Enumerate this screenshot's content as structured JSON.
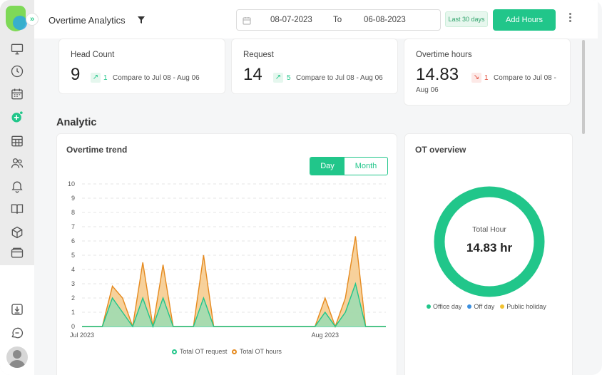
{
  "header": {
    "title": "Overtime Analytics",
    "date_from": "08-07-2023",
    "date_to_label": "To",
    "date_to": "06-08-2023",
    "range_badge": "Last 30 days",
    "add_button": "Add Hours"
  },
  "sidebar": {
    "icons": [
      "monitor-icon",
      "clock-icon",
      "calendar-icon",
      "add-circle-icon",
      "table-icon",
      "users-icon",
      "bell-icon",
      "book-icon",
      "box-icon",
      "wallet-icon",
      "download-icon",
      "chat-icon"
    ]
  },
  "stats": [
    {
      "label": "Head Count",
      "value": "9",
      "direction": "up",
      "change": "1",
      "compare": "Compare to Jul 08 - Aug 06"
    },
    {
      "label": "Request",
      "value": "14",
      "direction": "up",
      "change": "5",
      "compare": "Compare to Jul 08 - Aug 06"
    },
    {
      "label": "Overtime hours",
      "value": "14.83",
      "direction": "down",
      "change": "1",
      "compare": "Compare to Jul 08 -",
      "compare2": "Aug 06"
    }
  ],
  "analytic": {
    "section_title": "Analytic",
    "trend_title": "Overtime trend",
    "toggle_day": "Day",
    "toggle_month": "Month",
    "overview_title": "OT overview",
    "total_label": "Total Hour",
    "total_value": "14.83 hr"
  },
  "ot_legend": [
    {
      "label": "Office day",
      "color": "#21c68a"
    },
    {
      "label": "Off day",
      "color": "#3a8fe0"
    },
    {
      "label": "Public holiday",
      "color": "#f2c230"
    }
  ],
  "colors": {
    "accent": "#21c68a",
    "requests_fill": "#9fdcb1",
    "hours_fill": "#f6c98a",
    "hours_line": "#e58a1f"
  },
  "chart_data": {
    "type": "area",
    "x_tick_labels": [
      "Jul 2023",
      "Aug 2023"
    ],
    "x_tick_positions": [
      0,
      24
    ],
    "ylim": [
      0,
      10
    ],
    "y_ticks": [
      0,
      1,
      2,
      3,
      4,
      5,
      6,
      7,
      8,
      9,
      10
    ],
    "grid": true,
    "legend_placement": "bottom",
    "x": [
      0,
      1,
      2,
      3,
      4,
      5,
      6,
      7,
      8,
      9,
      10,
      11,
      12,
      13,
      14,
      15,
      16,
      17,
      18,
      19,
      20,
      21,
      22,
      23,
      24,
      25,
      26,
      27,
      28,
      29,
      30
    ],
    "series": [
      {
        "name": "Total OT request",
        "color": "#21c68a",
        "values": [
          0,
          0,
          0,
          2,
          1,
          0,
          2,
          0,
          2,
          0,
          0,
          0,
          2,
          0,
          0,
          0,
          0,
          0,
          0,
          0,
          0,
          0,
          0,
          0,
          1,
          0,
          1,
          3,
          0,
          0,
          0
        ]
      },
      {
        "name": "Total OT hours",
        "color": "#e58a1f",
        "values": [
          0,
          0,
          0,
          2.83,
          2,
          0,
          4.5,
          0,
          4.33,
          0,
          0,
          0,
          5,
          0,
          0,
          0,
          0,
          0,
          0,
          0,
          0,
          0,
          0,
          0,
          2,
          0,
          2,
          6.33,
          0,
          0,
          0
        ]
      }
    ]
  }
}
